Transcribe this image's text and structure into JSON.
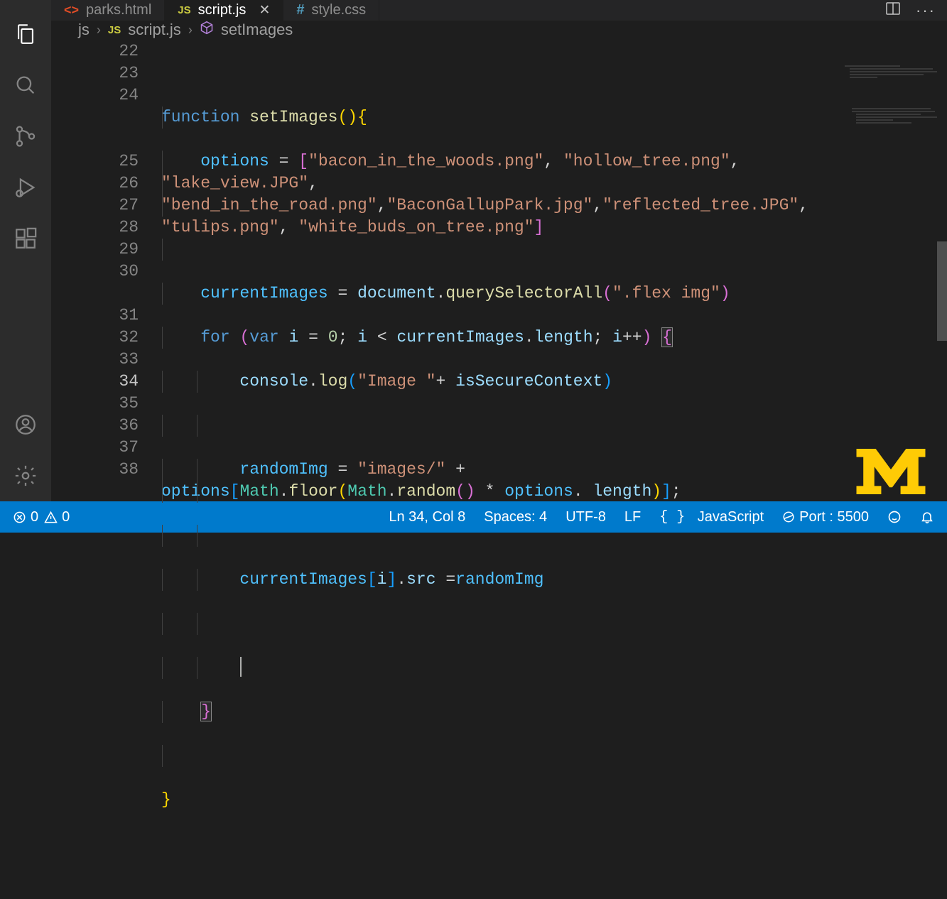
{
  "tabs": [
    {
      "lang": "<>",
      "label": "parks.html"
    },
    {
      "lang": "JS",
      "label": "script.js",
      "active": true,
      "hasClose": true
    },
    {
      "lang": "#",
      "label": "style.css"
    }
  ],
  "breadcrumb": {
    "folder": "js",
    "fileLang": "JS",
    "file": "script.js",
    "symbol": "setImages"
  },
  "lineNumbers": [
    22,
    23,
    24,
    25,
    26,
    27,
    28,
    29,
    30,
    31,
    32,
    33,
    34,
    35,
    36,
    37,
    38
  ],
  "currentLine": 34,
  "code": {
    "l23_kw": "function",
    "l23_fn": "setImages",
    "l24_var": "options",
    "l24_s1": "\"bacon_in_the_woods.png\"",
    "l24_s2": "\"hollow_tree.png\"",
    "l24_s3": "\"lake_view.JPG\"",
    "l24b_s1": "\"bend_in_the_road.png\"",
    "l24b_s2": "\"BaconGallupPark.jpg\"",
    "l24b_s3": "\"reflected_tree.JPG\"",
    "l24c_s1": "\"tulips.png\"",
    "l24c_s2": "\"white_buds_on_tree.png\"",
    "l26_var": "currentImages",
    "l26_doc": "document",
    "l26_fn": "querySelectorAll",
    "l26_str": "\".flex img\"",
    "l27_for": "for",
    "l27_var": "var",
    "l27_i": "i",
    "l27_eq": "=",
    "l27_zero": "0",
    "l27_ci": "currentImages",
    "l27_len": "length",
    "l27_pp": "++",
    "l28_console": "console",
    "l28_log": "log",
    "l28_str": "\"Image \"",
    "l28_isc": "isSecureContext",
    "l30_rimg": "randomImg",
    "l30_str": "\"images/\"",
    "l30_opt": "options",
    "l30_math": "Math",
    "l30_floor": "floor",
    "l30_random": "random",
    "l30b_len": "length",
    "l32_ci": "currentImages",
    "l32_i": "i",
    "l32_src": "src",
    "l32_rimg": "randomImg"
  },
  "status": {
    "errors": "0",
    "warnings": "0",
    "lnCol": "Ln 34, Col 8",
    "spaces": "Spaces: 4",
    "encoding": "UTF-8",
    "eol": "LF",
    "lang": "JavaScript",
    "port": "Port : 5500"
  }
}
